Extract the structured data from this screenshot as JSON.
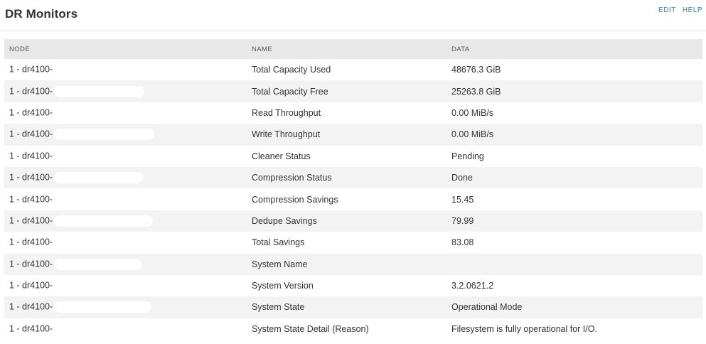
{
  "header": {
    "title": "DR Monitors",
    "edit_label": "EDIT",
    "help_label": "HELP"
  },
  "table": {
    "columns": [
      "NODE",
      "NAME",
      "DATA"
    ],
    "rows": [
      {
        "node": "1 - dr4100-",
        "name": "Total Capacity Used",
        "data": "48676.3 GiB"
      },
      {
        "node": "1 - dr4100-",
        "name": "Total Capacity Free",
        "data": "25263.8 GiB"
      },
      {
        "node": "1 - dr4100-",
        "name": "Read Throughput",
        "data": "0.00 MiB/s"
      },
      {
        "node": "1 - dr4100-",
        "name": "Write Throughput",
        "data": "0.00 MiB/s"
      },
      {
        "node": "1 - dr4100-",
        "name": "Cleaner Status",
        "data": "Pending"
      },
      {
        "node": "1 - dr4100-",
        "name": "Compression Status",
        "data": "Done"
      },
      {
        "node": "1 - dr4100-",
        "name": "Compression Savings",
        "data": "15.45"
      },
      {
        "node": "1 - dr4100-",
        "name": "Dedupe Savings",
        "data": "79.99"
      },
      {
        "node": "1 - dr4100-",
        "name": "Total Savings",
        "data": "83.08"
      },
      {
        "node": "1 - dr4100-",
        "name": "System Name",
        "data": ""
      },
      {
        "node": "1 - dr4100-",
        "name": "System Version",
        "data": "3.2.0621.2"
      },
      {
        "node": "1 - dr4100-",
        "name": "System State",
        "data": "Operational Mode"
      },
      {
        "node": "1 - dr4100-",
        "name": "System State Detail (Reason)",
        "data": "Filesystem is fully operational for I/O."
      }
    ]
  }
}
